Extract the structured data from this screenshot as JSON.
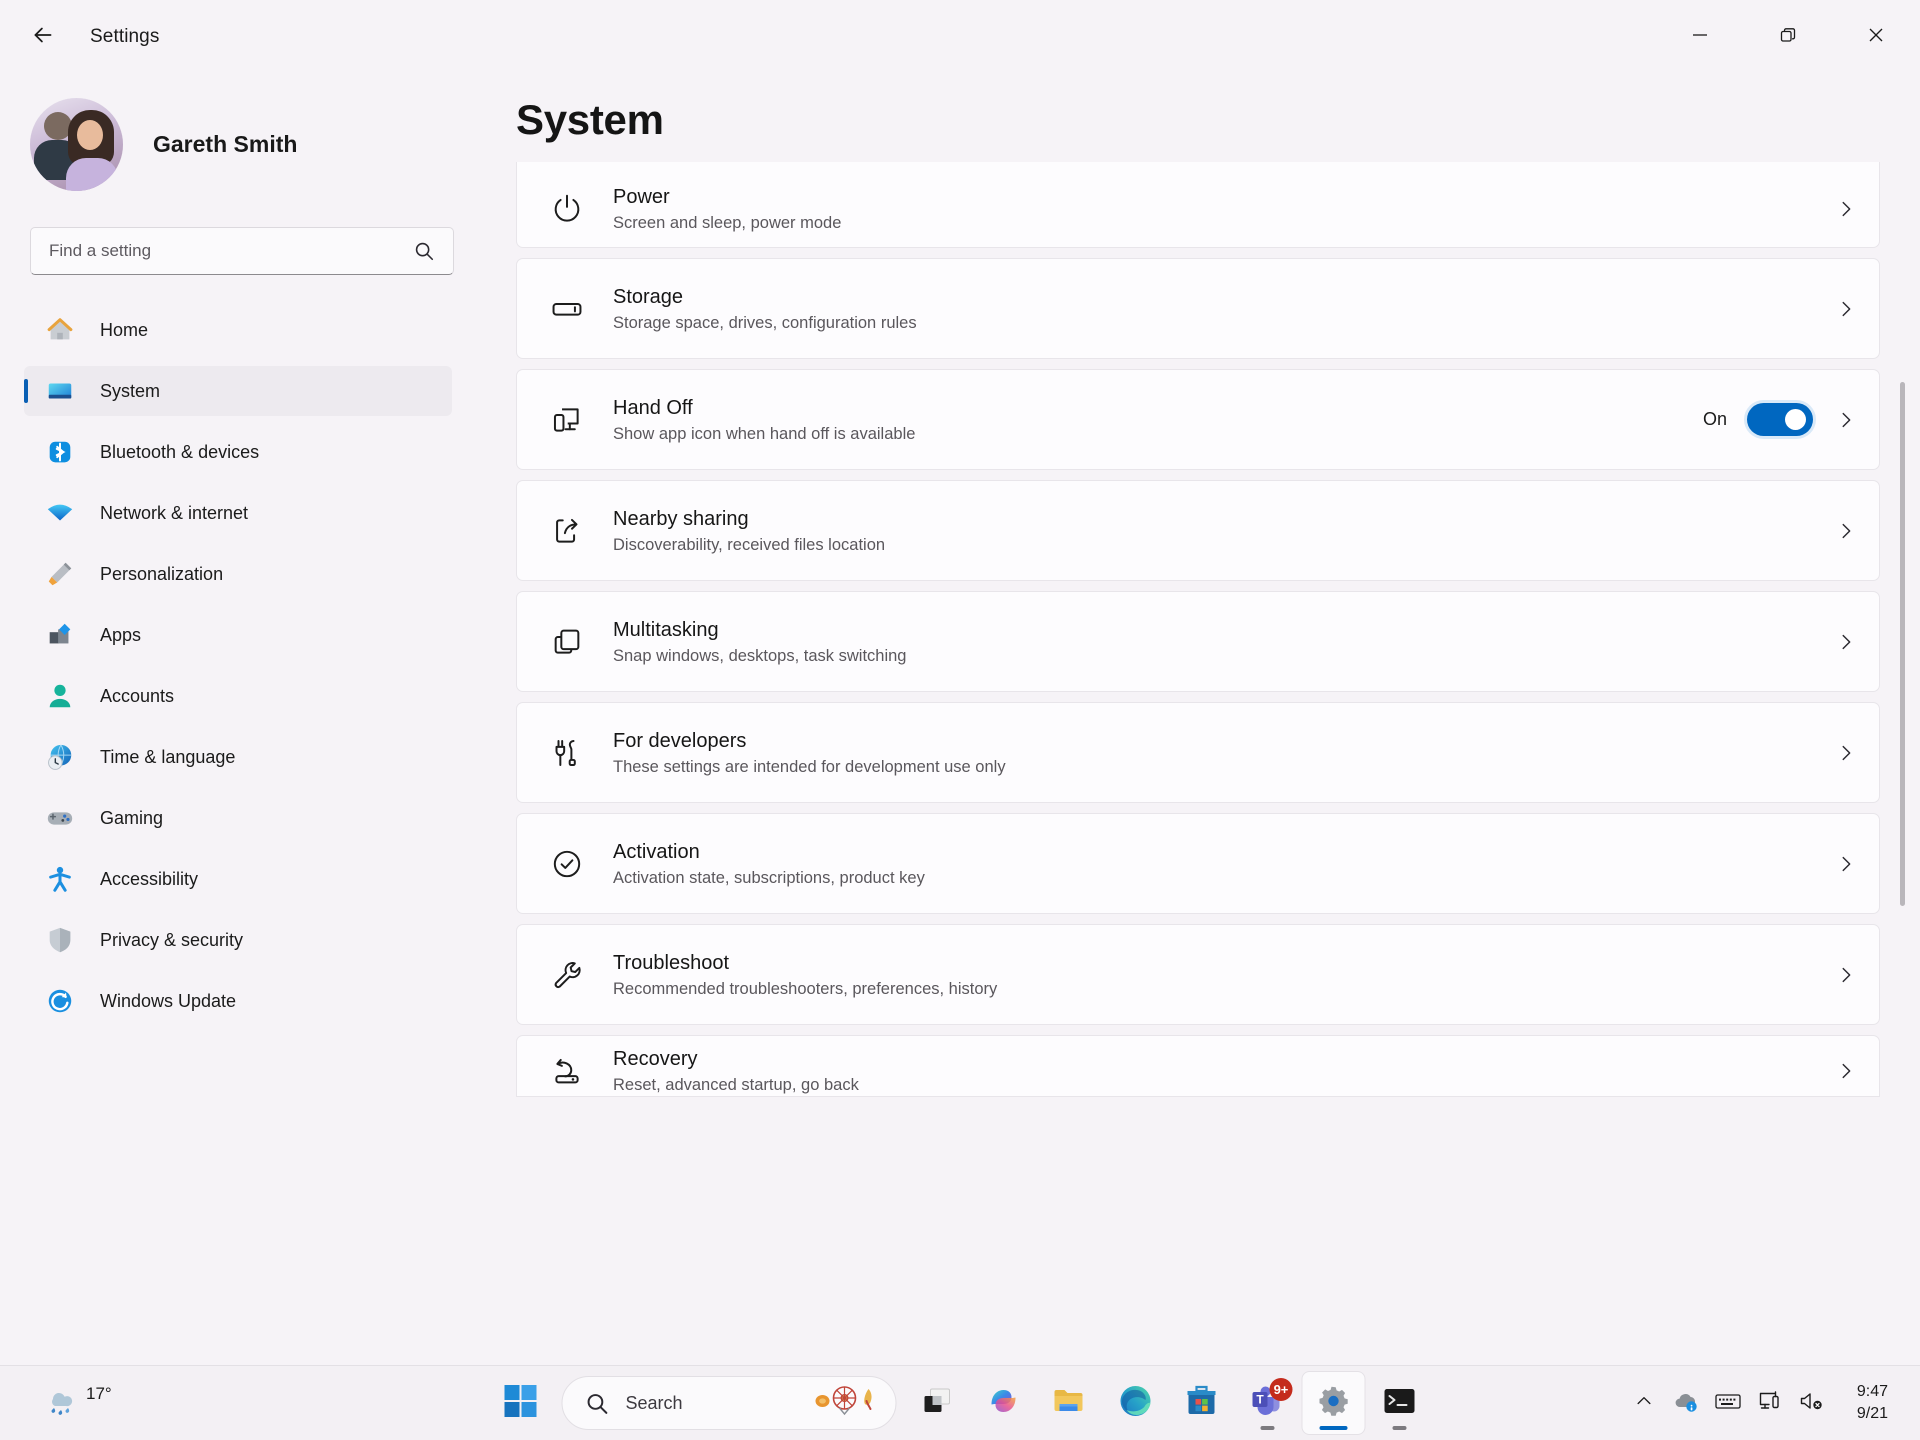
{
  "window": {
    "title": "Settings",
    "back_icon": "back-arrow-icon",
    "minimize_icon": "minimize-icon",
    "restore_icon": "restore-icon",
    "close_icon": "close-icon"
  },
  "sidebar": {
    "profile": {
      "name": "Gareth Smith",
      "avatar": "user-avatar"
    },
    "search": {
      "placeholder": "Find a setting",
      "value": "",
      "icon": "search-icon"
    },
    "items": [
      {
        "label": "Home",
        "icon": "home-icon",
        "active": false
      },
      {
        "label": "System",
        "icon": "system-monitor-icon",
        "active": true
      },
      {
        "label": "Bluetooth & devices",
        "icon": "bluetooth-icon",
        "active": false
      },
      {
        "label": "Network & internet",
        "icon": "wifi-icon",
        "active": false
      },
      {
        "label": "Personalization",
        "icon": "paintbrush-icon",
        "active": false
      },
      {
        "label": "Apps",
        "icon": "apps-icon",
        "active": false
      },
      {
        "label": "Accounts",
        "icon": "account-person-icon",
        "active": false
      },
      {
        "label": "Time & language",
        "icon": "clock-globe-icon",
        "active": false
      },
      {
        "label": "Gaming",
        "icon": "gamepad-icon",
        "active": false
      },
      {
        "label": "Accessibility",
        "icon": "accessibility-person-icon",
        "active": false
      },
      {
        "label": "Privacy & security",
        "icon": "shield-icon",
        "active": false
      },
      {
        "label": "Windows Update",
        "icon": "update-refresh-icon",
        "active": false
      }
    ]
  },
  "main": {
    "page_title": "System",
    "rows": [
      {
        "title": "Power",
        "subtitle": "Screen and sleep, power mode",
        "icon": "power-icon",
        "toggle": null
      },
      {
        "title": "Storage",
        "subtitle": "Storage space, drives, configuration rules",
        "icon": "storage-drive-icon",
        "toggle": null
      },
      {
        "title": "Hand Off",
        "subtitle": "Show app icon when hand off is available",
        "icon": "handoff-devices-icon",
        "toggle": "On"
      },
      {
        "title": "Nearby sharing",
        "subtitle": "Discoverability, received files location",
        "icon": "nearby-share-icon",
        "toggle": null
      },
      {
        "title": "Multitasking",
        "subtitle": "Snap windows, desktops, task switching",
        "icon": "multitasking-windows-icon",
        "toggle": null
      },
      {
        "title": "For developers",
        "subtitle": "These settings are intended for development use only",
        "icon": "developer-tools-icon",
        "toggle": null
      },
      {
        "title": "Activation",
        "subtitle": "Activation state, subscriptions, product key",
        "icon": "activation-check-icon",
        "toggle": null
      },
      {
        "title": "Troubleshoot",
        "subtitle": "Recommended troubleshooters, preferences, history",
        "icon": "wrench-icon",
        "toggle": null
      },
      {
        "title": "Recovery",
        "subtitle": "Reset, advanced startup, go back",
        "icon": "recovery-icon",
        "toggle": null
      }
    ],
    "chevron_icon": "chevron-right-icon",
    "accent_color": "#0067C0"
  },
  "taskbar": {
    "weather": {
      "temperature": "17°",
      "icon": "rain-weather-icon"
    },
    "start": {
      "icon": "windows-start-icon"
    },
    "search": {
      "placeholder": "Search",
      "icon": "search-icon",
      "decor_icon": "doodle-ferris-wheel-icon"
    },
    "apps": [
      {
        "name": "task-view",
        "icon": "task-view-icon",
        "badge": null,
        "state": "idle"
      },
      {
        "name": "copilot",
        "icon": "copilot-icon",
        "badge": null,
        "state": "idle"
      },
      {
        "name": "file-explorer",
        "icon": "file-explorer-icon",
        "badge": null,
        "state": "idle"
      },
      {
        "name": "edge",
        "icon": "edge-browser-icon",
        "badge": null,
        "state": "idle"
      },
      {
        "name": "microsoft-store",
        "icon": "microsoft-store-icon",
        "badge": null,
        "state": "idle"
      },
      {
        "name": "teams",
        "icon": "teams-icon",
        "badge": "9+",
        "state": "running"
      },
      {
        "name": "settings",
        "icon": "settings-gear-icon",
        "badge": null,
        "state": "active"
      },
      {
        "name": "terminal",
        "icon": "terminal-icon",
        "badge": null,
        "state": "running"
      }
    ],
    "tray": [
      {
        "name": "show-hidden-icons",
        "icon": "chevron-up-icon"
      },
      {
        "name": "onedrive",
        "icon": "onedrive-cloud-icon"
      },
      {
        "name": "touch-keyboard",
        "icon": "keyboard-icon"
      },
      {
        "name": "network-display",
        "icon": "display-connect-icon"
      },
      {
        "name": "volume-muted",
        "icon": "speaker-muted-icon"
      }
    ],
    "clock": {
      "time": "9:47",
      "date": "9/21"
    }
  }
}
